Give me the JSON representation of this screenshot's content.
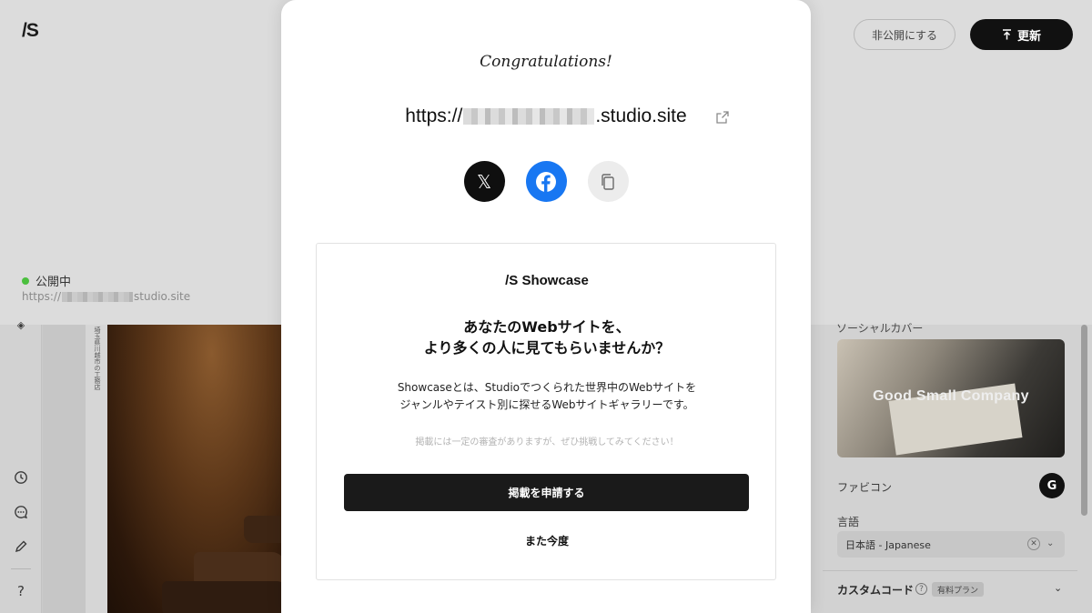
{
  "app": {
    "logo": "/S"
  },
  "header": {
    "unpublish_label": "非公開にする",
    "update_label": "更新",
    "update_icon": "upload-icon"
  },
  "status": {
    "label": "公開中",
    "url_prefix": "https://",
    "url_suffix": "studio.site",
    "dot_color": "#4bbf3e"
  },
  "left_rail": {
    "icons": [
      "history-icon",
      "comment-icon",
      "pen-icon",
      "help-icon"
    ],
    "help_label": "?"
  },
  "canvas": {
    "vertical_caption": "埼玉県川越市の工務店"
  },
  "right_panel": {
    "social_cover_label": "ソーシャルカバー",
    "cover_text": "Good Small Company",
    "favicon_label": "ファビコン",
    "favicon_letter": "G",
    "language_label": "言語",
    "language_value": "日本語 - Japanese",
    "custom_code_label": "カスタムコード",
    "paid_plan_badge": "有料プラン"
  },
  "modal": {
    "congrats": "Congratulations!",
    "url_prefix": "https://",
    "url_suffix": ".studio.site",
    "share": {
      "x_glyph": "𝕏",
      "icons": [
        "x-icon",
        "facebook-icon",
        "copy-icon"
      ],
      "facebook_color": "#1877f2"
    },
    "showcase": {
      "brand": "/S  Showcase",
      "headline_line1": "あなたのWebサイトを、",
      "headline_line2": "より多くの人に見てもらいませんか？",
      "desc_line1": "Showcaseとは、Studioでつくられた世界中のWebサイトを",
      "desc_line2": "ジャンルやテイスト別に探せるWebサイトギャラリーです。",
      "note": "掲載には一定の審査がありますが、ぜひ挑戦してみてください！",
      "apply_label": "掲載を申請する",
      "later_label": "また今度"
    }
  }
}
